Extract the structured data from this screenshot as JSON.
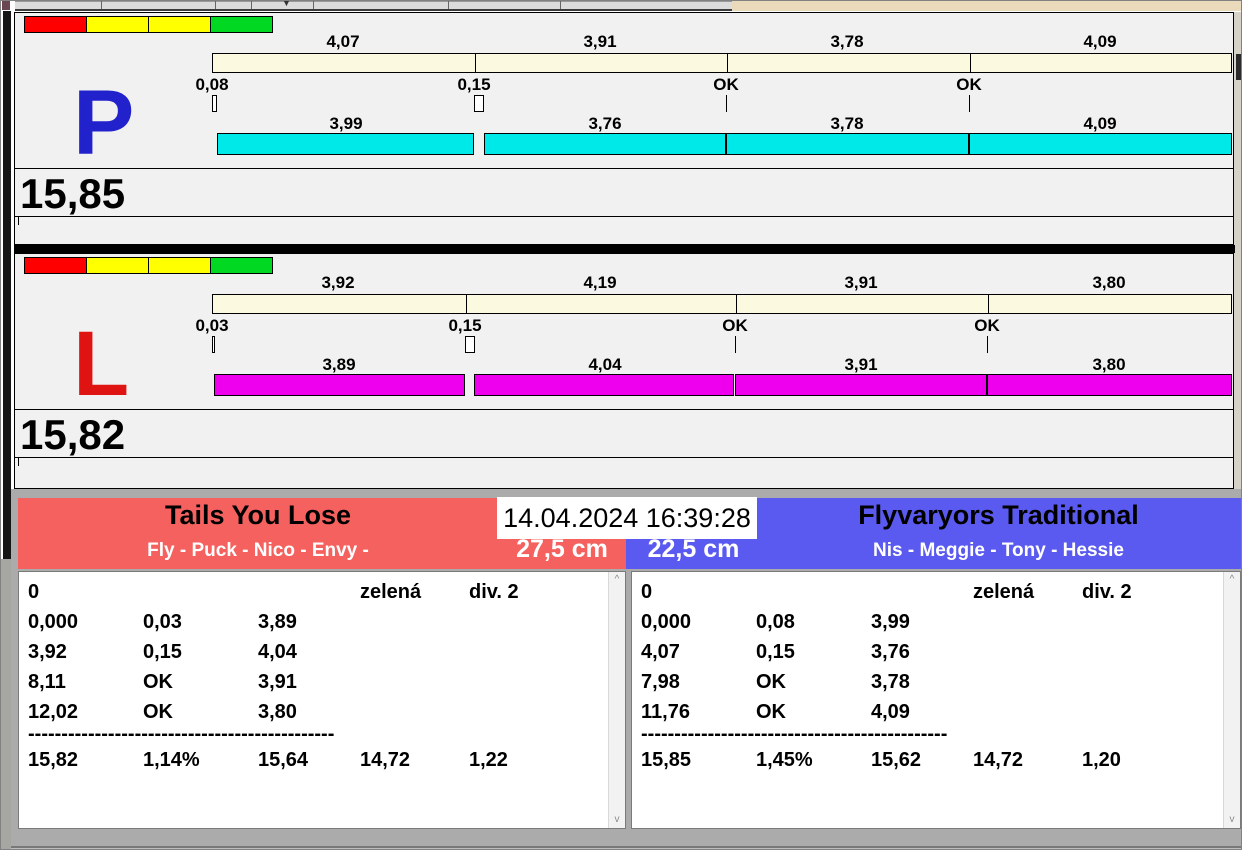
{
  "traffic_light": [
    "#FF0000",
    "#FFFF00",
    "#FFFF00",
    "#00D822"
  ],
  "lanes": [
    {
      "id": "P",
      "letter": "P",
      "letter_color": "#2222CC",
      "total_label": "15,85",
      "total_seconds": 15.85,
      "top_bar_color": "#FBF9E0",
      "bottom_bar_color": "#00E9E9",
      "top_segments": [
        {
          "label": "4,07",
          "value": 4.07
        },
        {
          "label": "3,91",
          "value": 3.91
        },
        {
          "label": "3,78",
          "value": 3.78
        },
        {
          "label": "4,09",
          "value": 4.09
        }
      ],
      "ticks": [
        {
          "label": "0,08",
          "value": 0.08,
          "type": "box"
        },
        {
          "label": "0,15",
          "value": 0.15,
          "type": "box"
        },
        {
          "label": "OK",
          "value": 0,
          "type": "line"
        },
        {
          "label": "OK",
          "value": 0,
          "type": "line"
        }
      ],
      "bottom_segments": [
        {
          "label": "3,99",
          "value": 3.99
        },
        {
          "label": "3,76",
          "value": 3.76
        },
        {
          "label": "3,78",
          "value": 3.78
        },
        {
          "label": "4,09",
          "value": 4.09
        }
      ]
    },
    {
      "id": "L",
      "letter": "L",
      "letter_color": "#E01313",
      "total_label": "15,82",
      "total_seconds": 15.82,
      "top_bar_color": "#FBF9E0",
      "bottom_bar_color": "#EE00EE",
      "top_segments": [
        {
          "label": "3,92",
          "value": 3.92
        },
        {
          "label": "4,19",
          "value": 4.19
        },
        {
          "label": "3,91",
          "value": 3.91
        },
        {
          "label": "3,80",
          "value": 3.8
        }
      ],
      "ticks": [
        {
          "label": "0,03",
          "value": 0.03,
          "type": "box"
        },
        {
          "label": "0,15",
          "value": 0.15,
          "type": "box"
        },
        {
          "label": "OK",
          "value": 0,
          "type": "line"
        },
        {
          "label": "OK",
          "value": 0,
          "type": "line"
        }
      ],
      "bottom_segments": [
        {
          "label": "3,89",
          "value": 3.89
        },
        {
          "label": "4,04",
          "value": 4.04
        },
        {
          "label": "3,91",
          "value": 3.91
        },
        {
          "label": "3,80",
          "value": 3.8
        }
      ]
    }
  ],
  "scoreboard": {
    "datetime": "14.04.2024 16:39:28",
    "teams": [
      {
        "name": "Tails You Lose",
        "dogs": "Fly - Puck - Nico - Envy -",
        "jump_height": "27,5 cm",
        "header_color": "#F4615E",
        "status_row": {
          "penalty": "0",
          "flag": "zelená",
          "division": "div. 2"
        },
        "runs": [
          [
            "0,000",
            "0,03",
            "3,89"
          ],
          [
            "3,92",
            "0,15",
            "4,04"
          ],
          [
            "8,11",
            "OK",
            "3,91"
          ],
          [
            "12,02",
            "OK",
            "3,80"
          ]
        ],
        "separator": "----------------------------------------------",
        "totals": [
          "15,82",
          "1,14%",
          "15,64",
          "14,72",
          "1,22"
        ]
      },
      {
        "name": "Flyvaryors Traditional",
        "dogs": "Nis - Meggie - Tony - Hessie",
        "jump_height": "22,5 cm",
        "header_color": "#5A5AF0",
        "status_row": {
          "penalty": "0",
          "flag": "zelená",
          "division": "div. 2"
        },
        "runs": [
          [
            "0,000",
            "0,08",
            "3,99"
          ],
          [
            "4,07",
            "0,15",
            "3,76"
          ],
          [
            "7,98",
            "OK",
            "3,78"
          ],
          [
            "11,76",
            "OK",
            "4,09"
          ]
        ],
        "separator": "----------------------------------------------",
        "totals": [
          "15,85",
          "1,45%",
          "15,62",
          "14,72",
          "1,20"
        ]
      }
    ],
    "scrollbar": {
      "up": "^",
      "down": "v"
    }
  }
}
